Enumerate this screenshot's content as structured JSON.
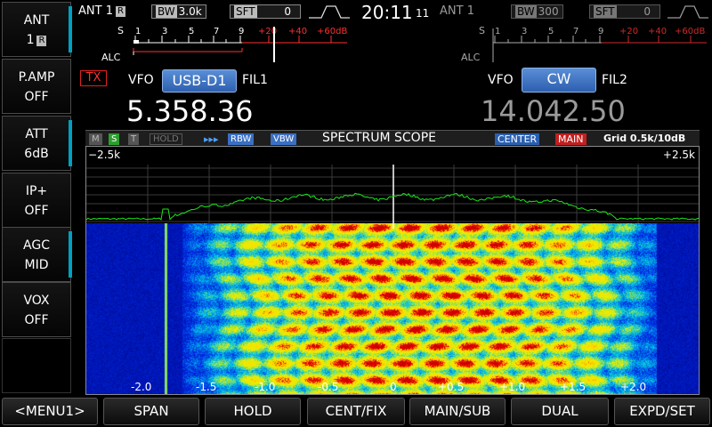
{
  "left_buttons": [
    {
      "l1": "ANT",
      "l2": "1",
      "r": "R",
      "accent": "#00a0c0"
    },
    {
      "l1": "P.AMP",
      "l2": "OFF",
      "accent": ""
    },
    {
      "l1": "ATT",
      "l2": "6dB",
      "accent": "#00a0c0"
    },
    {
      "l1": "IP+",
      "l2": "OFF",
      "accent": ""
    },
    {
      "l1": "AGC",
      "l2": "MID",
      "accent": "#00a0c0"
    },
    {
      "l1": "VOX",
      "l2": "OFF",
      "accent": ""
    }
  ],
  "main": {
    "ant": "ANT 1",
    "ant_r": "R",
    "bw_label": "BW",
    "bw_value": "3.0k",
    "sft_label": "SFT",
    "sft_value": "0",
    "meter_s": "S",
    "meter_alc": "ALC",
    "s_scale": [
      "1",
      "3",
      "5",
      "7",
      "9"
    ],
    "plus_scale": [
      "+20",
      "+40",
      "+60dB"
    ],
    "tx": "TX",
    "vfo": "VFO",
    "mode": "USB-D1",
    "fil": "FIL1",
    "freq": "5.358.36"
  },
  "clock": {
    "time": "20:11",
    "sec": "11"
  },
  "sub": {
    "ant": "ANT 1",
    "bw_label": "BW",
    "bw_value": "300",
    "sft_label": "SFT",
    "sft_value": "0",
    "meter_s": "S",
    "meter_alc": "ALC",
    "s_scale": [
      "1",
      "3",
      "5",
      "7",
      "9"
    ],
    "plus_scale": [
      "+20",
      "+40",
      "+60dB"
    ],
    "vfo": "VFO",
    "mode": "CW",
    "fil": "FIL2",
    "freq": "14.042.50"
  },
  "scope": {
    "tags": {
      "m": "M",
      "s": "S",
      "t": "T",
      "hold": "HOLD",
      "arrows": "▸▸▸",
      "rbw": "RBW",
      "vbw": "VBW"
    },
    "title": "SPECTRUM SCOPE",
    "center": "CENTER",
    "main": "MAIN",
    "grid": "Grid 0.5k/10dB",
    "left_edge": "−2.5k",
    "right_edge": "+2.5k",
    "marker": "»",
    "colors": {
      "trace": "#19e619",
      "center_line": "#ffffff"
    }
  },
  "x_axis": [
    "-2.0",
    "-1.5",
    "-1.0",
    "-0.5",
    "0",
    "+0.5",
    "+1.0",
    "+1.5",
    "+2.0"
  ],
  "bottom_buttons": [
    "<MENU1>",
    "SPAN",
    "HOLD",
    "CENT/FIX",
    "MAIN/SUB",
    "DUAL",
    "EXPD/SET"
  ]
}
